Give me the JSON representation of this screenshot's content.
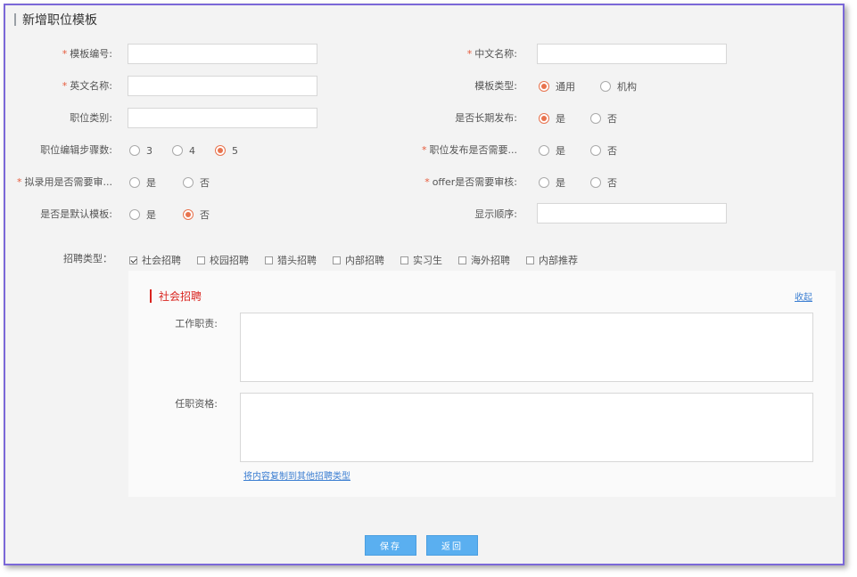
{
  "page": {
    "title": "新增职位模板"
  },
  "form": {
    "template_no": {
      "label": "模板编号:",
      "value": "",
      "required": true
    },
    "cn_name": {
      "label": "中文名称:",
      "value": "",
      "required": true
    },
    "en_name": {
      "label": "英文名称:",
      "value": "",
      "required": true
    },
    "template_type": {
      "label": "模板类型:",
      "options": [
        "通用",
        "机构"
      ],
      "selected": "通用"
    },
    "job_category": {
      "label": "职位类别:",
      "value": ""
    },
    "long_term": {
      "label": "是否长期发布:",
      "options": [
        "是",
        "否"
      ],
      "selected": "是"
    },
    "edit_steps": {
      "label": "职位编辑步骤数:",
      "options": [
        "3",
        "4",
        "5"
      ],
      "selected": "5"
    },
    "publish_approval": {
      "label": "职位发布是否需要...",
      "options": [
        "是",
        "否"
      ],
      "selected": "",
      "required": true
    },
    "hire_approval": {
      "label": "拟录用是否需要审...",
      "options": [
        "是",
        "否"
      ],
      "selected": "",
      "required": true
    },
    "offer_approval": {
      "label": "offer是否需要审核:",
      "options": [
        "是",
        "否"
      ],
      "selected": "",
      "required": true
    },
    "default_template": {
      "label": "是否是默认模板:",
      "options": [
        "是",
        "否"
      ],
      "selected": "否"
    },
    "display_order": {
      "label": "显示顺序:",
      "value": ""
    },
    "recruit_types": {
      "label": "招聘类型：",
      "options": [
        {
          "text": "社会招聘",
          "checked": true
        },
        {
          "text": "校园招聘",
          "checked": false
        },
        {
          "text": "猎头招聘",
          "checked": false
        },
        {
          "text": "内部招聘",
          "checked": false
        },
        {
          "text": "实习生",
          "checked": false
        },
        {
          "text": "海外招聘",
          "checked": false
        },
        {
          "text": "内部推荐",
          "checked": false
        }
      ]
    }
  },
  "panel": {
    "title": "社会招聘",
    "collapse_label": "收起",
    "duties_label": "工作职责:",
    "duties_value": "",
    "qualifications_label": "任职资格:",
    "qualifications_value": "",
    "copy_link": "将内容复制到其他招聘类型"
  },
  "buttons": {
    "save": "保存",
    "back": "返回"
  },
  "colors": {
    "accent": "#e8734e",
    "primary_button": "#5aaff0",
    "panel_mark": "#d9241f",
    "frame_border": "#7b68d8"
  }
}
